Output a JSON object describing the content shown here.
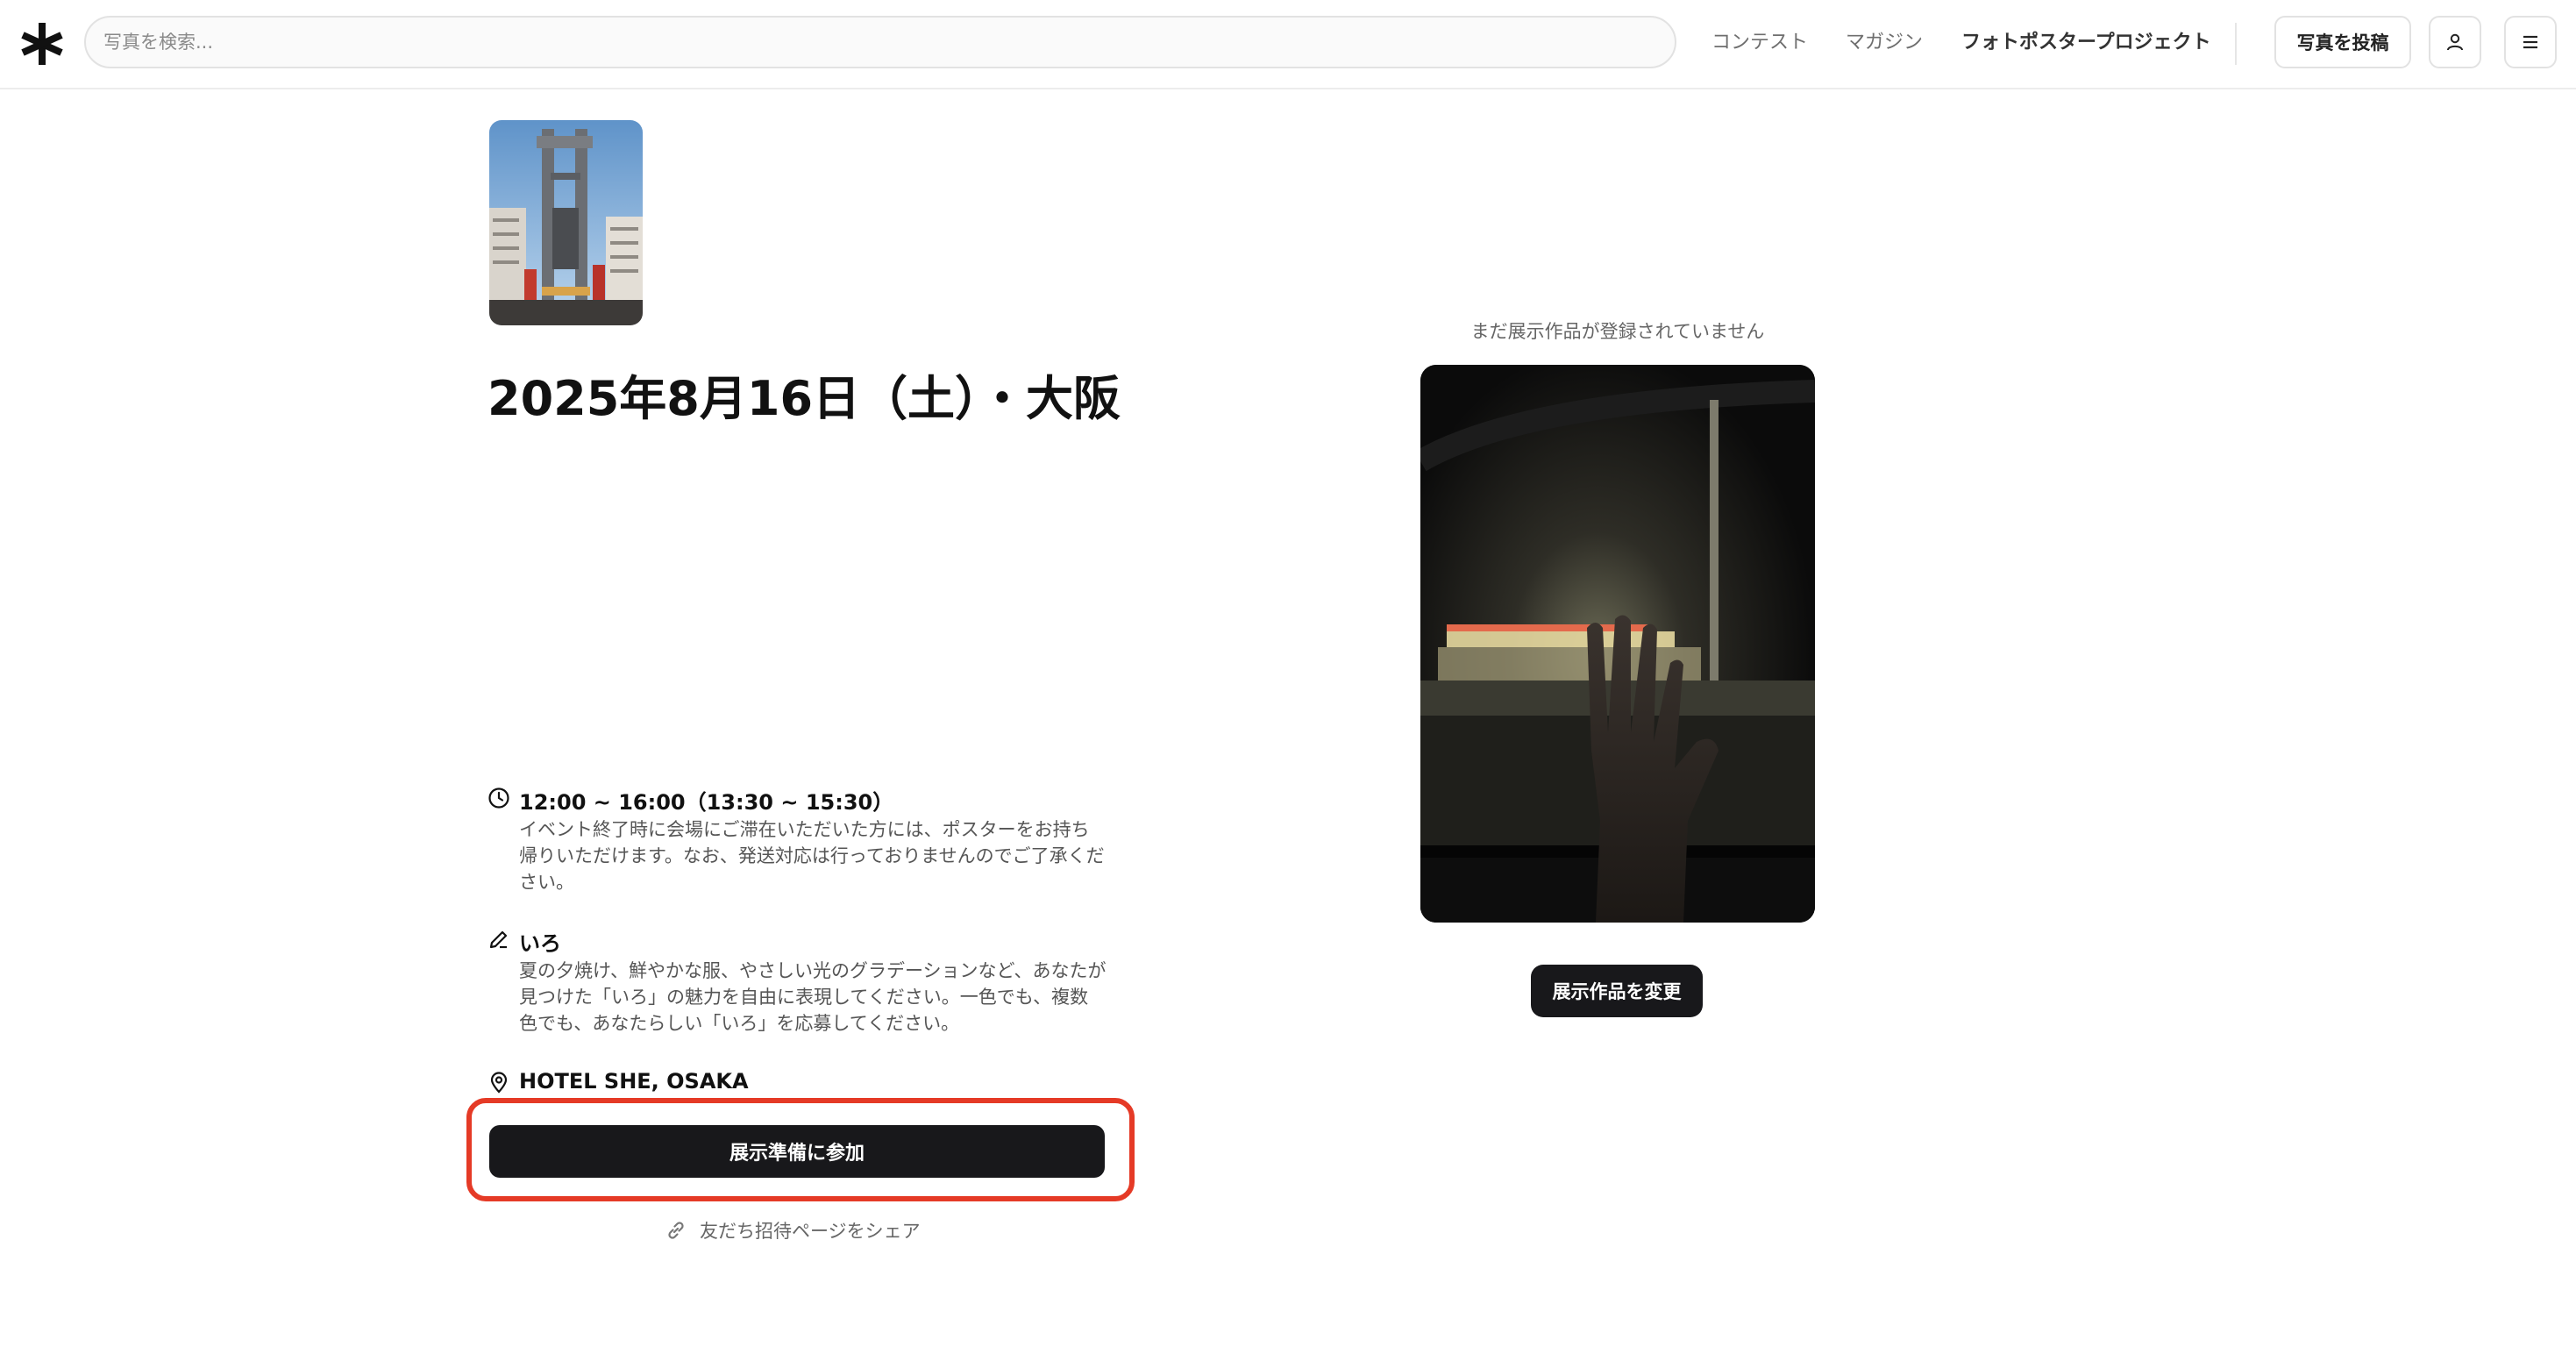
{
  "header": {
    "search_placeholder": "写真を検索...",
    "nav": [
      {
        "label": "コンテスト"
      },
      {
        "label": "マガジン"
      },
      {
        "label": "フォトポスタープロジェクト"
      }
    ],
    "post_button": "写真を投稿",
    "icons": {
      "logo": "asterisk-logo",
      "profile": "user-icon",
      "menu": "hamburger-menu-icon"
    }
  },
  "event": {
    "title": "2025年8月16日（土）・大阪",
    "time": {
      "icon": "clock-icon",
      "label": "12:00 ~ 16:00（13:30 ~ 15:30）",
      "description": "イベント終了時に会場にご滞在いただいた方には、ポスターをお持ち帰りいただけます。なお、発送対応は行っておりませんのでご了承ください。"
    },
    "theme": {
      "icon": "pencil-icon",
      "label": "いろ",
      "description": "夏の夕焼け、鮮やかな服、やさしい光のグラデーションなど、あなたが見つけた「いろ」の魅力を自由に表現してください。一色でも、複数色でも、あなたらしい「いろ」を応募してください。"
    },
    "location": {
      "icon": "map-pin-icon",
      "label": "HOTEL SHE, OSAKA"
    },
    "join_button": "展示準備に参加",
    "share_link": "友だち招待ページをシェア",
    "share_icon": "link-icon"
  },
  "exhibit": {
    "status": "まだ展示作品が登録されていません",
    "change_button": "展示作品を変更"
  },
  "colors": {
    "primary_button": "#18181b",
    "highlight_border": "#e53a26",
    "muted_text": "#666666"
  }
}
